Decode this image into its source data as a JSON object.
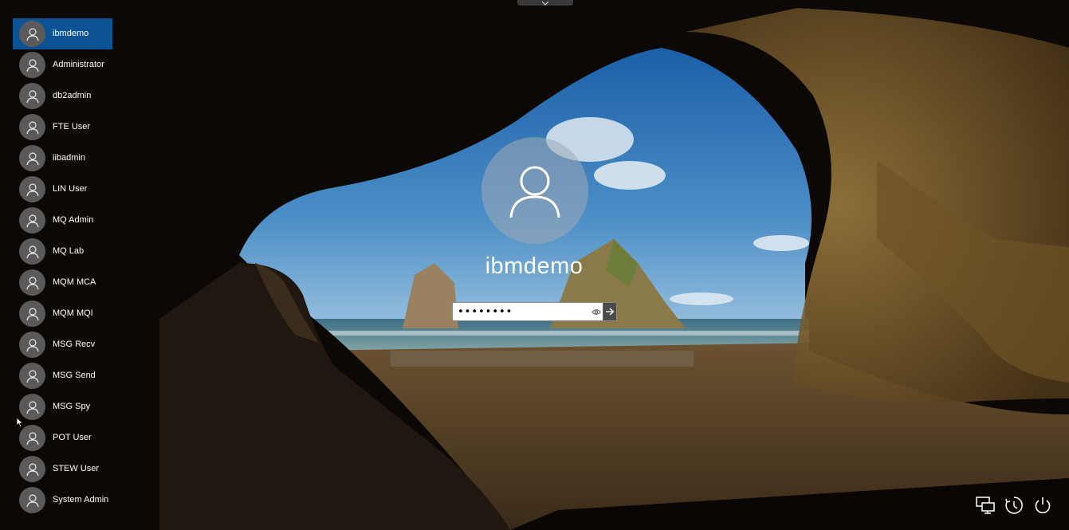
{
  "users": [
    {
      "name": "ibmdemo",
      "selected": true
    },
    {
      "name": "Administrator"
    },
    {
      "name": "db2admin"
    },
    {
      "name": "FTE User"
    },
    {
      "name": "iibadmin"
    },
    {
      "name": "LIN User"
    },
    {
      "name": "MQ Admin"
    },
    {
      "name": "MQ Lab"
    },
    {
      "name": "MQM MCA"
    },
    {
      "name": "MQM MQI"
    },
    {
      "name": "MSG Recv"
    },
    {
      "name": "MSG Send"
    },
    {
      "name": "MSG Spy"
    },
    {
      "name": "POT User"
    },
    {
      "name": "STEW User"
    },
    {
      "name": "System Admin"
    }
  ],
  "login": {
    "username": "ibmdemo",
    "password_value": "••••••••"
  },
  "icons": {
    "reveal": "eye-icon",
    "submit": "arrow-right-icon",
    "bottom": [
      "network-icon",
      "ease-of-access-icon",
      "power-icon"
    ],
    "top": "chevron-down-icon"
  },
  "colors": {
    "selected_user": "#0b5394",
    "avatar": "#5a5a5a"
  }
}
